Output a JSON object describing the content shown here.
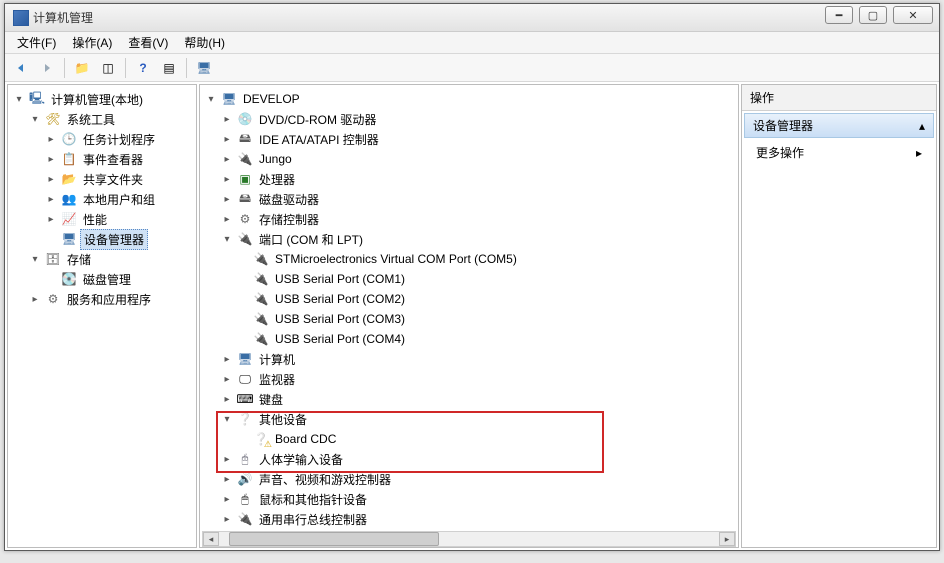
{
  "window": {
    "title": "计算机管理"
  },
  "menubar": {
    "file": "文件(F)",
    "action": "操作(A)",
    "view": "查看(V)",
    "help": "帮助(H)"
  },
  "left_tree": {
    "root": "计算机管理(本地)",
    "systools": "系统工具",
    "scheduler": "任务计划程序",
    "eventvwr": "事件查看器",
    "shared": "共享文件夹",
    "users": "本地用户和组",
    "perf": "性能",
    "devmgr": "设备管理器",
    "storage": "存储",
    "diskmgmt": "磁盘管理",
    "services": "服务和应用程序"
  },
  "dev_tree": {
    "root": "DEVELOP",
    "dvd": "DVD/CD-ROM 驱动器",
    "ide": "IDE ATA/ATAPI 控制器",
    "jungo": "Jungo",
    "cpu": "处理器",
    "disk": "磁盘驱动器",
    "storage": "存储控制器",
    "ports": "端口 (COM 和 LPT)",
    "port0": "STMicroelectronics Virtual COM Port (COM5)",
    "port1": "USB Serial Port (COM1)",
    "port2": "USB Serial Port (COM2)",
    "port3": "USB Serial Port (COM3)",
    "port4": "USB Serial Port (COM4)",
    "computer": "计算机",
    "monitor": "监视器",
    "keyboard": "键盘",
    "other": "其他设备",
    "boardcdc": "Board CDC",
    "hid": "人体学输入设备",
    "sound": "声音、视频和游戏控制器",
    "mouse": "鼠标和其他指针设备",
    "usb": "通用串行总线控制器"
  },
  "actions": {
    "header": "操作",
    "group": "设备管理器",
    "more": "更多操作"
  }
}
